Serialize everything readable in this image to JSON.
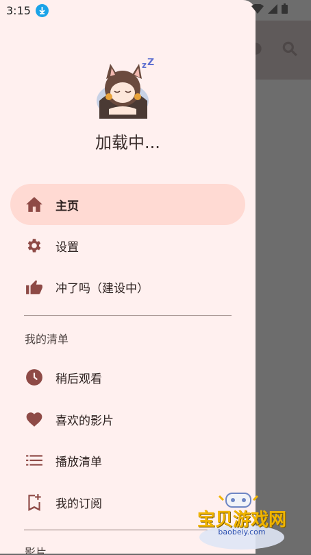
{
  "status": {
    "time": "3:15"
  },
  "drawer": {
    "loading_text": "加载中...",
    "nav": [
      {
        "label": "主页",
        "icon": "home-icon",
        "active": true
      },
      {
        "label": "设置",
        "icon": "gear-icon",
        "active": false
      },
      {
        "label": "冲了吗（建设中）",
        "icon": "thumbs-up-icon",
        "active": false
      }
    ],
    "section_my_list": "我的清单",
    "list_items": [
      {
        "label": "稍后观看",
        "icon": "clock-icon"
      },
      {
        "label": "喜欢的影片",
        "icon": "heart-icon"
      },
      {
        "label": "播放清单",
        "icon": "list-icon"
      },
      {
        "label": "我的订阅",
        "icon": "bookmark-add-icon"
      }
    ],
    "section_films": "影片"
  },
  "watermark": {
    "text": "宝贝游戏网",
    "url": "baobeiy.com"
  },
  "colors": {
    "drawer_bg": "#fff0ef",
    "active_bg": "#ffdad3",
    "icon": "#8e4a46"
  }
}
